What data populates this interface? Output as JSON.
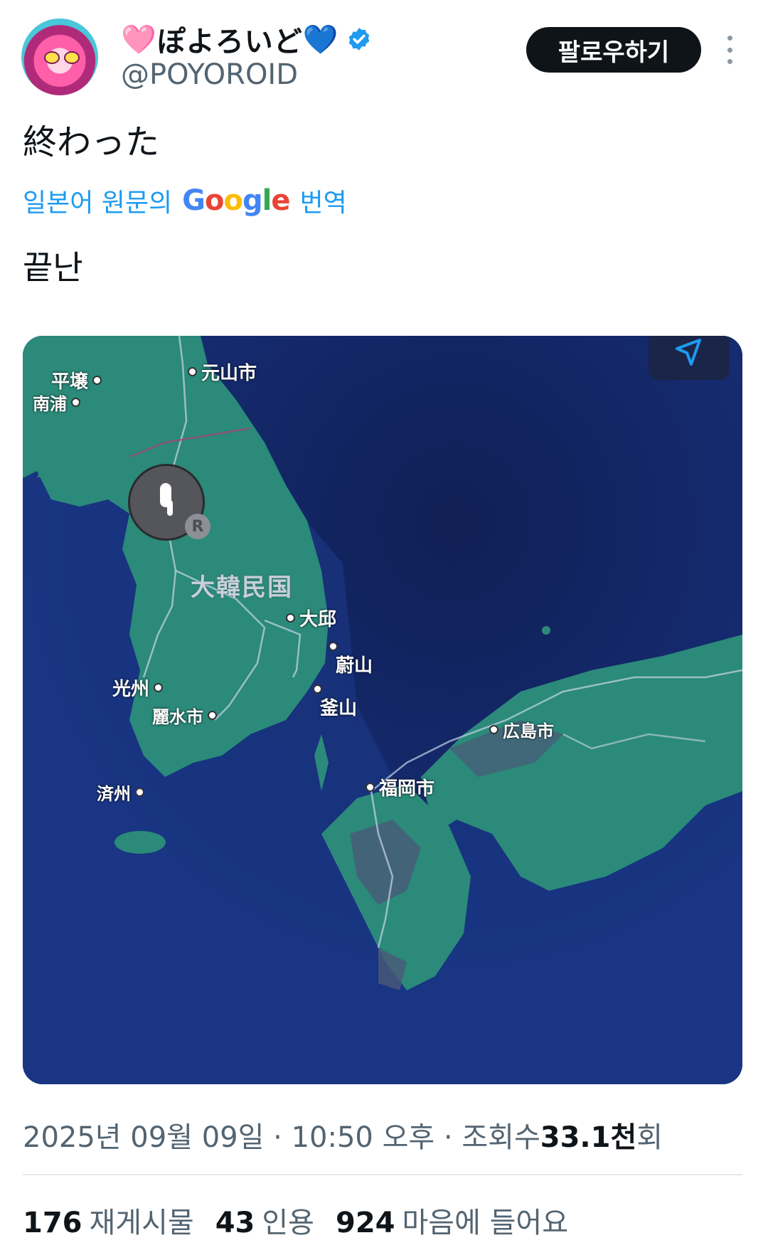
{
  "author": {
    "heart_left": "🩷",
    "display_name": "ぽよろいど",
    "heart_right": "💙",
    "handle": "@POYOROID",
    "verified": true,
    "avatar_icon": "anime-avatar"
  },
  "follow_label": "팔로우하기",
  "more_icon": "more-vertical-icon",
  "tweet": {
    "text": "終わった",
    "translation_prefix": "일본어 원문의",
    "translation_brand": "Google",
    "translation_suffix": "번역",
    "translated_text": "끝난"
  },
  "map": {
    "labels": {
      "pyongyang": "平壌",
      "nampo": "南浦",
      "wonsan": "元山市",
      "korea": "大韓民国",
      "daegu": "大邱",
      "ulsan": "蔚山",
      "busan": "釜山",
      "gwangju": "光州",
      "yeosu": "麗水市",
      "jeju": "済州",
      "fukuoka": "福岡市",
      "hiroshima": "広島市"
    },
    "device_badge": "R",
    "device_icon": "airpods-icon",
    "location_icon": "location-arrow-icon",
    "colors": {
      "sea": "#14286e",
      "land": "#2b8a7a",
      "urban": "#4a5a78"
    }
  },
  "meta": {
    "date": "2025년 09월 09일",
    "sep1": "·",
    "time": "10:50 오후",
    "sep2": "·",
    "views_label": "조회수",
    "views_value": "33.1천",
    "views_suffix": "회"
  },
  "stats": {
    "reposts_count": "176",
    "reposts_label": "재게시물",
    "quotes_count": "43",
    "quotes_label": "인용",
    "likes_count": "924",
    "likes_label": "마음에 들어요"
  }
}
